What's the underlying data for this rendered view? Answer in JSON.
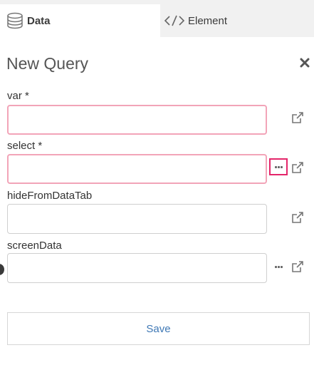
{
  "tabs": {
    "data": {
      "label": "Data",
      "icon": "database-icon"
    },
    "element": {
      "label": "Element",
      "icon": "code-icon"
    }
  },
  "panel": {
    "title": "New Query",
    "close_icon": "close-icon"
  },
  "fields": [
    {
      "label": "var *",
      "value": "",
      "required": true,
      "has_more": false
    },
    {
      "label": "select *",
      "value": "",
      "required": true,
      "has_more": true
    },
    {
      "label": "hideFromDataTab",
      "value": "",
      "required": false,
      "has_more": false
    },
    {
      "label": "screenData",
      "value": "",
      "required": false,
      "has_more": true
    }
  ],
  "save_label": "Save",
  "colors": {
    "required_border": "#f2a4b8",
    "highlight": "#e4266a",
    "link": "#3f78b5"
  }
}
